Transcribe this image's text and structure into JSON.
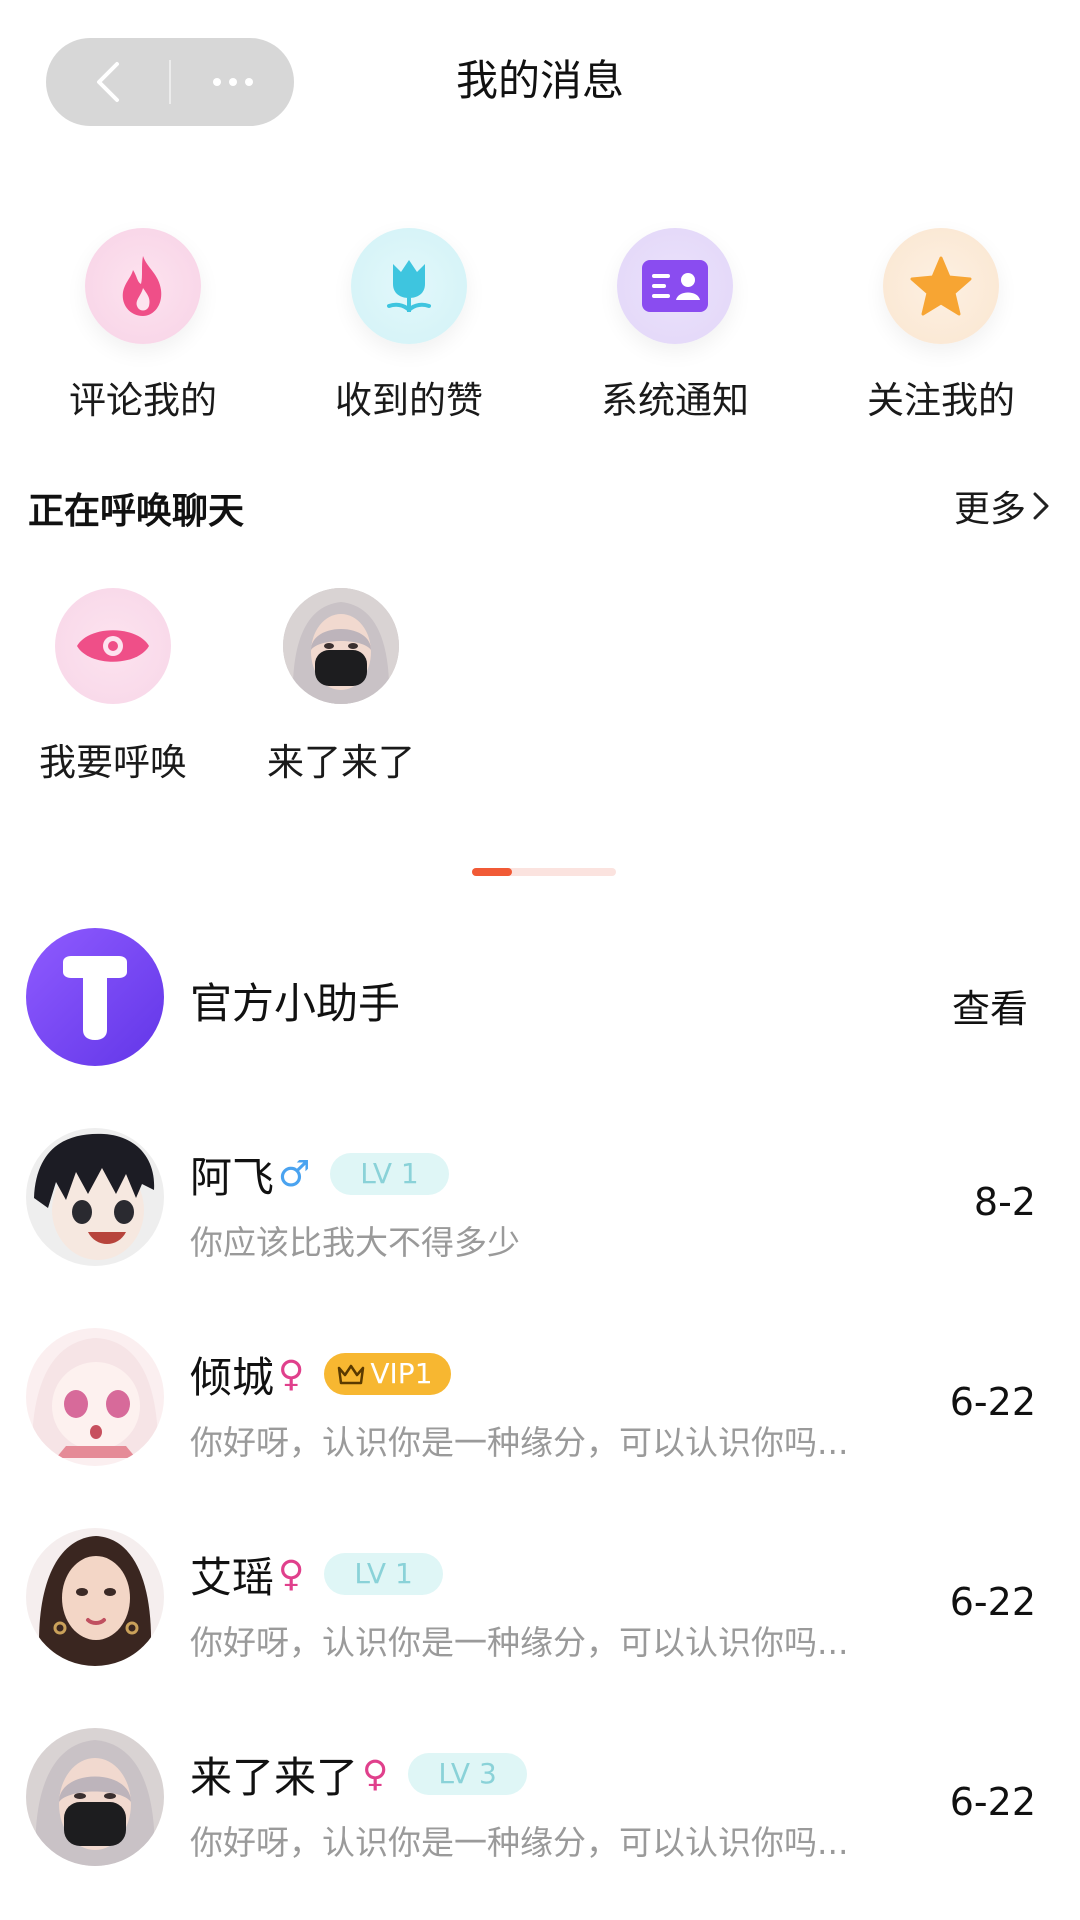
{
  "header": {
    "title": "我的消息"
  },
  "quick_actions": [
    {
      "label": "评论我的",
      "icon": "flame-icon",
      "color": "#ef4f88"
    },
    {
      "label": "收到的赞",
      "icon": "tulip-icon",
      "color": "#3ec5df"
    },
    {
      "label": "系统通知",
      "icon": "id-card-icon",
      "color": "#8a4cf0"
    },
    {
      "label": "关注我的",
      "icon": "star-icon",
      "color": "#f7a533"
    }
  ],
  "summon_section": {
    "title": "正在呼唤聊天",
    "more_label": "更多",
    "items": [
      {
        "label": "我要呼唤",
        "icon": "eye-icon"
      },
      {
        "label": "来了来了",
        "icon": "avatar"
      }
    ]
  },
  "official": {
    "name": "官方小助手",
    "action": "查看"
  },
  "chats": [
    {
      "name": "阿飞",
      "gender": "♂",
      "gender_color": "#4aa3f0",
      "badge": "LV 1",
      "badge_type": "lv",
      "preview": "你应该比我大不得多少",
      "date": "8-2"
    },
    {
      "name": "倾城",
      "gender": "♀",
      "gender_color": "#e0408c",
      "badge": "VIP1",
      "badge_type": "vip",
      "preview": "你好呀，认识你是一种缘分，可以认识你吗...",
      "date": "6-22"
    },
    {
      "name": "艾瑶",
      "gender": "♀",
      "gender_color": "#e0408c",
      "badge": "LV 1",
      "badge_type": "lv",
      "preview": "你好呀，认识你是一种缘分，可以认识你吗...",
      "date": "6-22"
    },
    {
      "name": "来了来了",
      "gender": "♀",
      "gender_color": "#e0408c",
      "badge": "LV 3",
      "badge_type": "lv",
      "preview": "你好呀，认识你是一种缘分，可以认识你吗...",
      "date": "6-22"
    }
  ]
}
